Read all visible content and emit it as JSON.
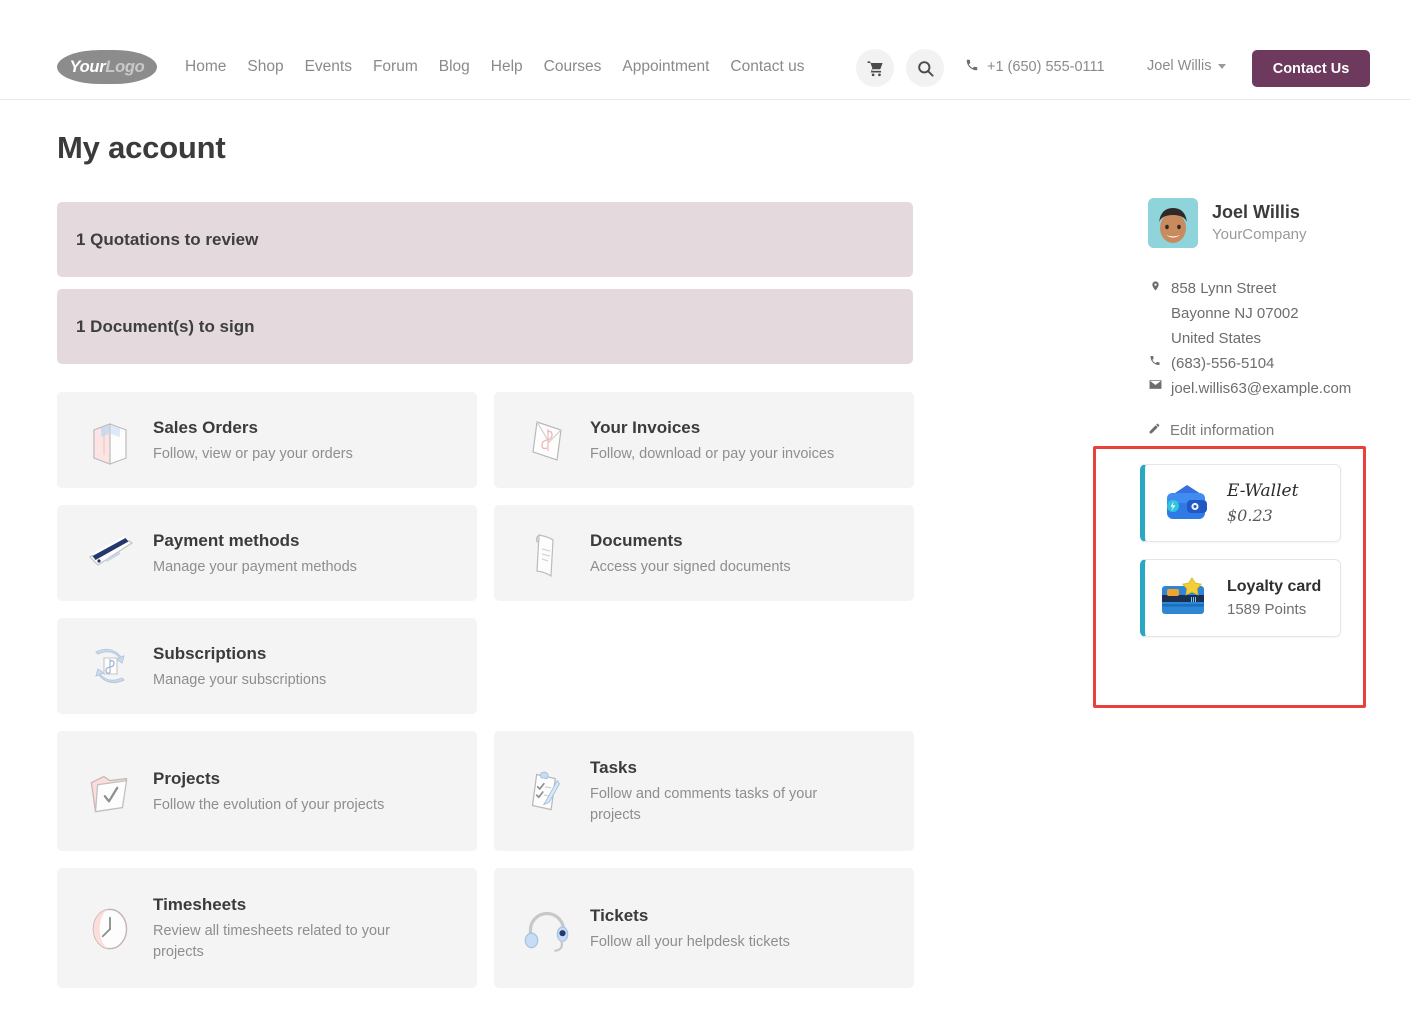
{
  "header": {
    "logo": {
      "part1": "Your",
      "part2": "Logo"
    },
    "nav": [
      {
        "label": "Home"
      },
      {
        "label": "Shop"
      },
      {
        "label": "Events"
      },
      {
        "label": "Forum"
      },
      {
        "label": "Blog"
      },
      {
        "label": "Help"
      },
      {
        "label": "Courses"
      },
      {
        "label": "Appointment"
      },
      {
        "label": "Contact us"
      }
    ],
    "cart_icon": "shopping-cart-icon",
    "search_icon": "search-icon",
    "phone": "+1 (650) 555-0111",
    "user": "Joel Willis",
    "contact_button": "Contact Us",
    "accent_color": "#6d3a5d"
  },
  "page": {
    "title": "My account"
  },
  "alerts": [
    {
      "label": "1 Quotations to review"
    },
    {
      "label": "1 Document(s) to sign"
    }
  ],
  "cards_group_a": [
    {
      "title": "Sales Orders",
      "subtitle": "Follow, view or pay your orders",
      "icon": "shopping-bag-icon"
    },
    {
      "title": "Your Invoices",
      "subtitle": "Follow, download or pay your invoices",
      "icon": "invoice-envelope-icon"
    },
    {
      "title": "Payment methods",
      "subtitle": "Manage your payment methods",
      "icon": "credit-card-icon"
    },
    {
      "title": "Documents",
      "subtitle": "Access your signed documents",
      "icon": "document-scroll-icon"
    },
    {
      "title": "Subscriptions",
      "subtitle": "Manage your subscriptions",
      "icon": "subscription-recycle-icon"
    }
  ],
  "cards_group_b": [
    {
      "title": "Projects",
      "subtitle": "Follow the evolution of your projects",
      "icon": "folder-check-icon"
    },
    {
      "title": "Tasks",
      "subtitle": "Follow and comments tasks of your projects",
      "icon": "clipboard-task-icon"
    },
    {
      "title": "Timesheets",
      "subtitle": "Review all timesheets related to your projects",
      "icon": "clock-icon"
    },
    {
      "title": "Tickets",
      "subtitle": "Follow all your helpdesk tickets",
      "icon": "headset-icon"
    }
  ],
  "sidebar": {
    "name": "Joel Willis",
    "company": "YourCompany",
    "avatar": "user-avatar",
    "address_line1": "858 Lynn Street",
    "address_line2": "Bayonne NJ 07002",
    "address_line3": "United States",
    "phone": "(683)-556-5104",
    "email": "joel.willis63@example.com",
    "edit_link": "Edit information",
    "location_icon": "map-pin-icon",
    "phone_icon": "phone-icon",
    "email_icon": "envelope-icon",
    "edit_icon": "pencil-icon"
  },
  "wallets": {
    "highlight_color": "#e8403a",
    "accent_color": "#29a8c4",
    "items": [
      {
        "title": "E-Wallet",
        "value": "$0.23",
        "icon": "wallet-icon",
        "style": "handwritten"
      },
      {
        "title": "Loyalty card",
        "value": "1589 Points",
        "icon": "loyalty-card-icon",
        "style": "normal"
      }
    ]
  }
}
